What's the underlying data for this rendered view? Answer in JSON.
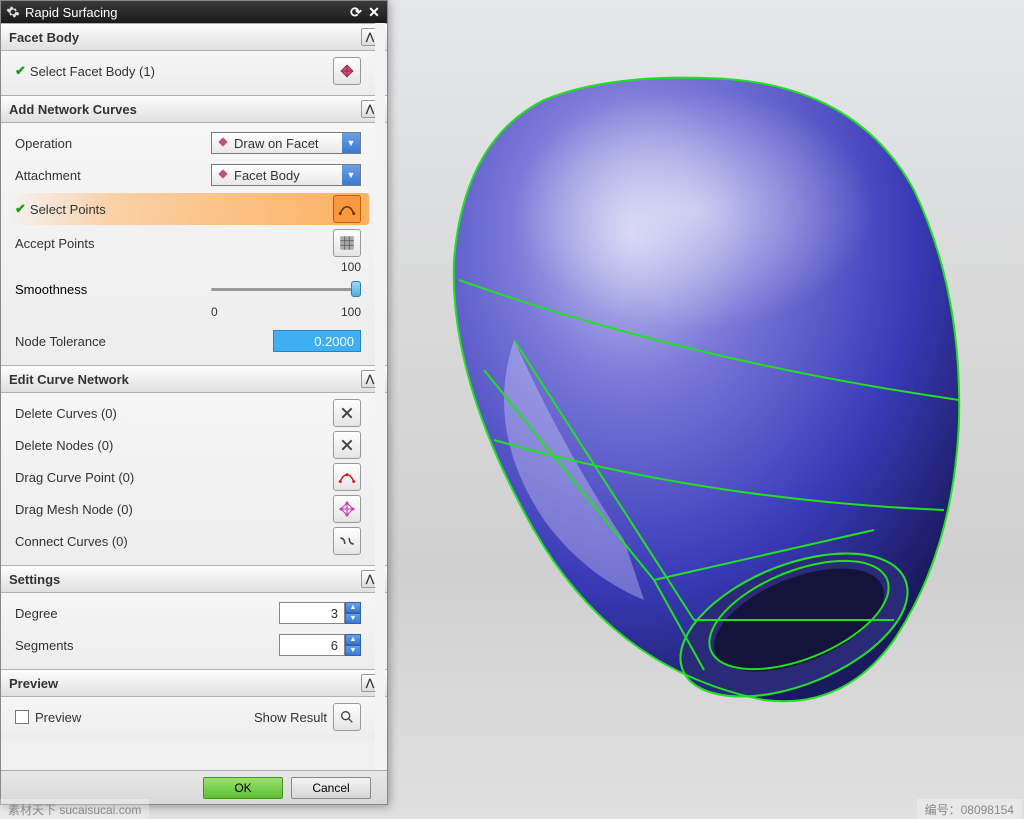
{
  "titlebar": {
    "title": "Rapid Surfacing"
  },
  "facet_body": {
    "header": "Facet Body",
    "select_label": "Select Facet Body (1)"
  },
  "network_curves": {
    "header": "Add Network Curves",
    "operation_label": "Operation",
    "operation_value": "Draw on Facet",
    "attachment_label": "Attachment",
    "attachment_value": "Facet Body",
    "select_points": "Select Points",
    "accept_points": "Accept Points",
    "smoothness_label": "Smoothness",
    "smooth_top": "100",
    "smooth_min": "0",
    "smooth_max": "100",
    "tolerance_label": "Node Tolerance",
    "tolerance_value": "0.2000"
  },
  "edit_curve": {
    "header": "Edit Curve Network",
    "delete_curves": "Delete Curves (0)",
    "delete_nodes": "Delete Nodes (0)",
    "drag_curve": "Drag Curve Point (0)",
    "drag_mesh": "Drag Mesh Node (0)",
    "connect_curves": "Connect Curves (0)"
  },
  "settings": {
    "header": "Settings",
    "degree_label": "Degree",
    "degree_value": "3",
    "segments_label": "Segments",
    "segments_value": "6"
  },
  "preview": {
    "header": "Preview",
    "checkbox_label": "Preview",
    "show_result": "Show Result"
  },
  "footer": {
    "ok": "OK",
    "cancel": "Cancel"
  },
  "watermark": {
    "left": "素材天下 sucaisucai.com",
    "id_label": "编号：08098154"
  }
}
